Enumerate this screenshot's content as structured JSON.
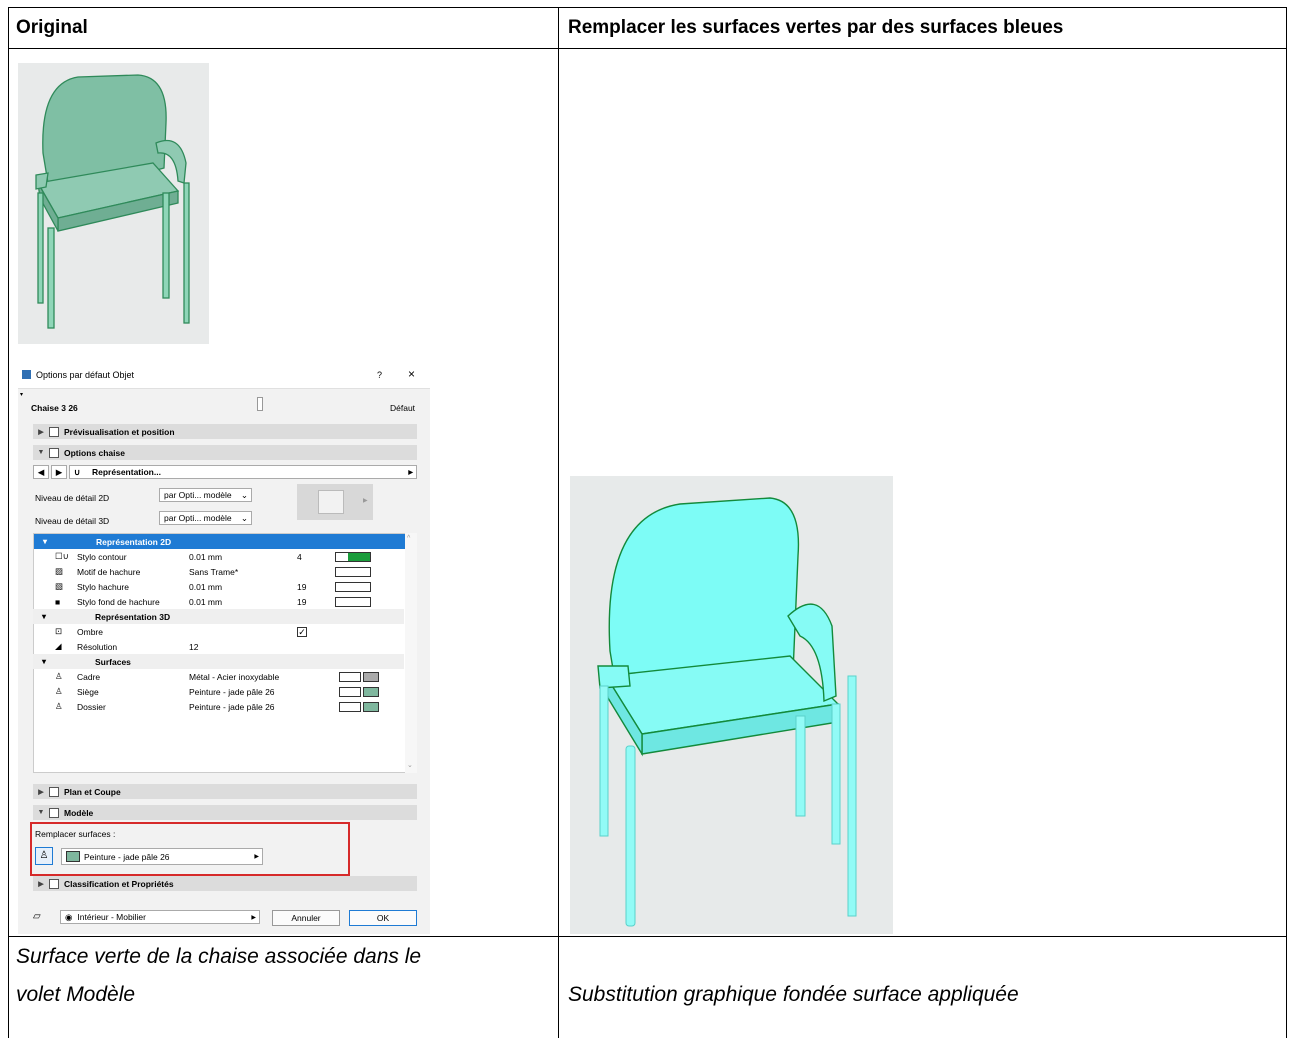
{
  "table": {
    "col1_header": "Original",
    "col2_header": "Remplacer les surfaces vertes par des surfaces bleues",
    "col1_caption_line1": "Surface verte de la chaise associée dans le",
    "col1_caption_line2": "volet Modèle",
    "col2_caption": "Substitution graphique fondée surface appliquée"
  },
  "colors": {
    "original_chair": "#7fbfa4",
    "blue_chair": "#7dfcf6",
    "chair_outline": "#138a3b",
    "highlight_box": "#d62a2a",
    "selection_blue": "#1f7bd4"
  },
  "dialog": {
    "title": "Options par défaut Objet",
    "help": "?",
    "close": "×",
    "object_name": "Chaise 3 26",
    "default_label": "Défaut",
    "sections": {
      "preview": "Prévisualisation et position",
      "options": "Options chaise",
      "representation": "Représentation...",
      "plan": "Plan et Coupe",
      "model": "Modèle",
      "classification": "Classification et Propriétés"
    },
    "detail_2d_label": "Niveau de détail 2D",
    "detail_2d_value": "par Opti... modèle",
    "detail_3d_label": "Niveau de détail 3D",
    "detail_3d_value": "par Opti... modèle",
    "param_groups": {
      "rep2d": "Représentation 2D",
      "rep3d": "Représentation 3D",
      "surfaces": "Surfaces"
    },
    "rows_2d": [
      {
        "label": "Stylo contour",
        "value": "0.01 mm",
        "num": "4"
      },
      {
        "label": "Motif de hachure",
        "value": "Sans Trame*",
        "num": ""
      },
      {
        "label": "Stylo hachure",
        "value": "0.01 mm",
        "num": "19"
      },
      {
        "label": "Stylo fond de hachure",
        "value": "0.01 mm",
        "num": "19"
      }
    ],
    "rows_3d": [
      {
        "label": "Ombre",
        "value": "",
        "check": "✓"
      },
      {
        "label": "Résolution",
        "value": "12"
      }
    ],
    "rows_surf": [
      {
        "label": "Cadre",
        "value": "Métal - Acier inoxydable"
      },
      {
        "label": "Siège",
        "value": "Peinture - jade pâle 26"
      },
      {
        "label": "Dossier",
        "value": "Peinture - jade pâle 26"
      }
    ],
    "override_label": "Remplacer surfaces :",
    "override_value": "Peinture - jade pâle 26",
    "layer_value": "Intérieur - Mobilier",
    "cancel": "Annuler",
    "ok": "OK"
  }
}
